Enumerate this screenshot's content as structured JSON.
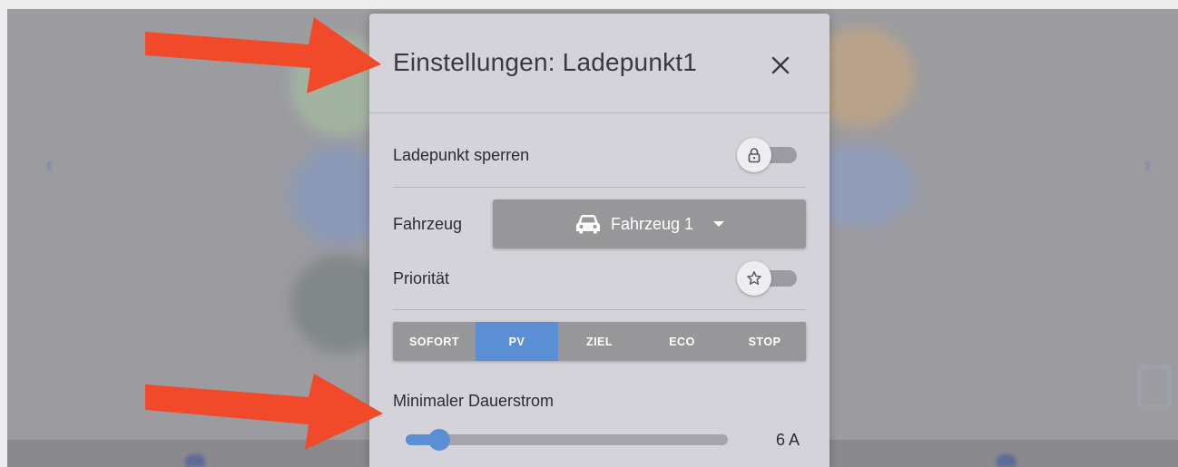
{
  "dialog": {
    "title": "Einstellungen: Ladepunkt1",
    "close_icon": "close-icon"
  },
  "lock": {
    "label": "Ladepunkt sperren",
    "icon": "lock-icon",
    "on": false
  },
  "vehicle": {
    "label": "Fahrzeug",
    "selected": "Fahrzeug 1",
    "icon": "car-icon"
  },
  "priority": {
    "label": "Priorität",
    "icon": "star-icon",
    "on": false
  },
  "modes": {
    "items": [
      "SOFORT",
      "PV",
      "ZIEL",
      "ECO",
      "STOP"
    ],
    "active": "PV"
  },
  "min_current": {
    "label": "Minimaler Dauerstrom",
    "value": "6 A",
    "fraction": 0.07
  },
  "colors": {
    "accent": "#5b8fd4",
    "annotation_arrow": "#f04a2a"
  }
}
